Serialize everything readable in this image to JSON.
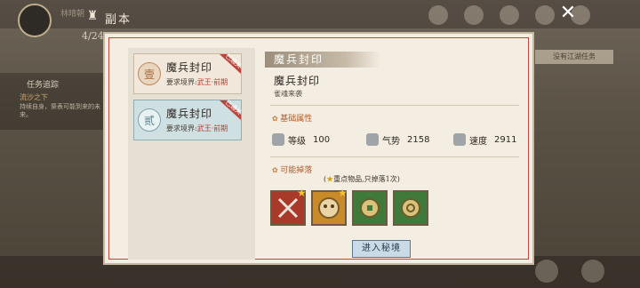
{
  "hud": {
    "player_name": "林晴朝",
    "progress": "4/24",
    "title": "副本",
    "tracker_title": "任务追踪",
    "tracker_line": "流沙之下",
    "tracker_desc": "持续自身，祭表可能到来的未来。",
    "right_task": "没有江湖任务"
  },
  "list": {
    "items": [
      {
        "seal": "壹",
        "name": "魔兵封印",
        "req_prefix": "要求境界:",
        "req_value": "武王·前期",
        "tag": "已通关",
        "selected": false
      },
      {
        "seal": "贰",
        "name": "魔兵封印",
        "req_prefix": "要求境界:",
        "req_value": "武王·前期",
        "tag": "已通关",
        "selected": true
      }
    ]
  },
  "detail": {
    "banner": "魔兵封印",
    "name": "魔兵封印",
    "sub": "雀魂来袭",
    "basic_title": "基础属性",
    "stats": [
      {
        "icon": "level-icon",
        "label": "等级",
        "value": "100"
      },
      {
        "icon": "momentum-icon",
        "label": "气势",
        "value": "2158"
      },
      {
        "icon": "speed-icon",
        "label": "速度",
        "value": "2911"
      }
    ],
    "drops_title": "可能掉落",
    "drops_note_open": "(",
    "drops_note": "重点物品,只掉落1次",
    "drops_note_close": ")",
    "drops": [
      {
        "icon": "crossed-blades-icon",
        "color": "#a93a2a",
        "starred": true
      },
      {
        "icon": "beast-mask-icon",
        "color": "#c98a2a",
        "starred": true
      },
      {
        "icon": "coin-icon",
        "color": "#3f7a3a",
        "starred": false
      },
      {
        "icon": "coin-icon",
        "color": "#3f7a3a",
        "starred": false
      }
    ],
    "enter_label": "进入秘境"
  },
  "colors": {
    "accent_red": "#c23a2a",
    "selected_card": "#cfe0e2"
  }
}
